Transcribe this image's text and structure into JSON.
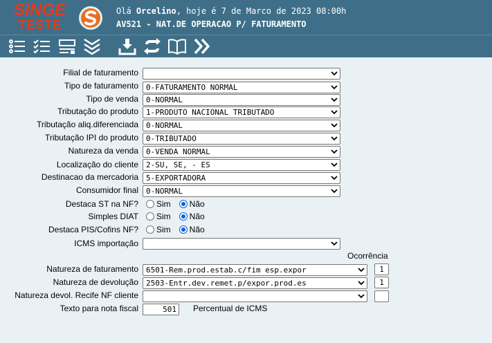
{
  "header": {
    "logo_line1": "SINGE",
    "logo_line2": "TESTE",
    "greeting_prefix": "Olá ",
    "user_name": "Orcelino",
    "greeting_suffix": ", hoje é 7 de Marco de 2023 08:00h",
    "screen_title": "AV521 - NAT.DE OPERACAO P/ FATURAMENTO"
  },
  "toolbar": {
    "buttons": [
      "list-icon",
      "checklist-icon",
      "form-icon",
      "collapse-icon",
      "save-icon",
      "refresh-icon",
      "book-icon",
      "forward-icon"
    ]
  },
  "form": {
    "filial": {
      "label": "Filial de faturamento",
      "value": ""
    },
    "tipo_faturamento": {
      "label": "Tipo de faturamento",
      "value": "0-FATURAMENTO NORMAL"
    },
    "tipo_venda": {
      "label": "Tipo de venda",
      "value": "0-NORMAL"
    },
    "tributacao_produto": {
      "label": "Tributação do produto",
      "value": "1-PRODUTO NACIONAL TRIBUTADO"
    },
    "tributacao_aliq": {
      "label": "Tributação aliq.diferenciada",
      "value": "0-NORMAL"
    },
    "tributacao_ipi": {
      "label": "Tributação IPI do produto",
      "value": "0-TRIBUTADO"
    },
    "natureza_venda": {
      "label": "Natureza da venda",
      "value": "0-VENDA NORMAL"
    },
    "localizacao_cliente": {
      "label": "Localização do cliente",
      "value": "2-SU, SE, - ES"
    },
    "destinacao_mercadoria": {
      "label": "Destinacao da mercadoria",
      "value": "5-EXPORTADORA"
    },
    "consumidor_final": {
      "label": "Consumidor final",
      "value": "0-NORMAL"
    },
    "destaca_st": {
      "label": "Destaca ST na NF?",
      "yes": "Sim",
      "no": "Não",
      "selected": "Não"
    },
    "simples_diat": {
      "label": "Simples DIAT",
      "yes": "Sim",
      "no": "Não",
      "selected": "Não"
    },
    "destaca_pis": {
      "label": "Destaca PIS/Cofins NF?",
      "yes": "Sim",
      "no": "Não",
      "selected": "Não"
    },
    "icms_importacao": {
      "label": "ICMS importação",
      "value": ""
    },
    "ocorrencia_header": "Ocorrência",
    "natureza_faturamento": {
      "label": "Natureza de faturamento",
      "value": "6501-Rem.prod.estab.c/fim esp.expor",
      "ocorrencia": "1"
    },
    "natureza_devolucao": {
      "label": "Natureza de devolução",
      "value": "2503-Entr.dev.remet.p/expor.prod.es",
      "ocorrencia": "1"
    },
    "natureza_recife": {
      "label": "Natureza devol. Recife NF cliente",
      "value": "",
      "ocorrencia": ""
    },
    "texto_nota": {
      "label": "Texto para nota fiscal",
      "value": "501"
    },
    "percentual_icms": {
      "label": "Percentual de ICMS"
    }
  },
  "colors": {
    "header_bg": "#3f6f88",
    "page_bg": "#eaf1f5",
    "logo_red": "#e23b1e",
    "radio_blue": "#0b5fd6"
  }
}
